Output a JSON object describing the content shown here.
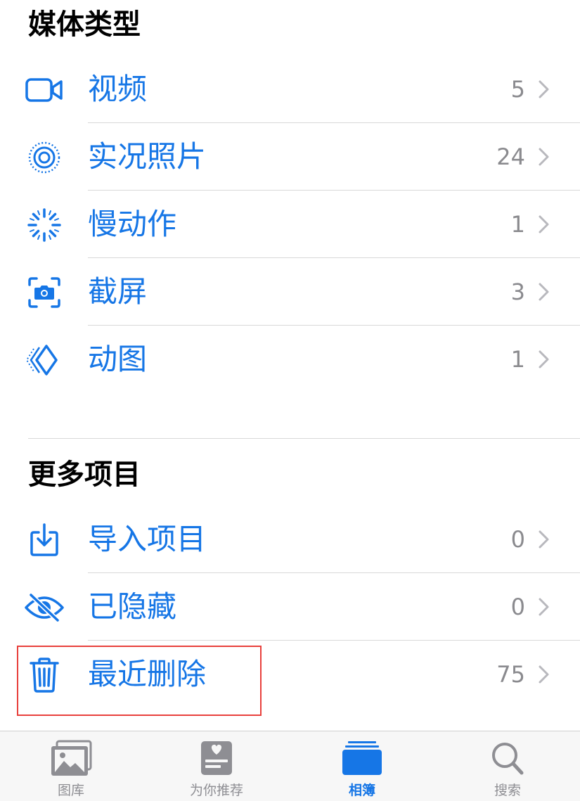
{
  "sections": {
    "media_types": {
      "title": "媒体类型",
      "items": [
        {
          "label": "视频",
          "count": "5",
          "icon": "video-camera-icon"
        },
        {
          "label": "实况照片",
          "count": "24",
          "icon": "live-photo-icon"
        },
        {
          "label": "慢动作",
          "count": "1",
          "icon": "slow-motion-icon"
        },
        {
          "label": "截屏",
          "count": "3",
          "icon": "screenshot-icon"
        },
        {
          "label": "动图",
          "count": "1",
          "icon": "animated-icon"
        }
      ]
    },
    "more_items": {
      "title": "更多项目",
      "items": [
        {
          "label": "导入项目",
          "count": "0",
          "icon": "import-icon"
        },
        {
          "label": "已隐藏",
          "count": "0",
          "icon": "eye-slash-icon"
        },
        {
          "label": "最近删除",
          "count": "75",
          "icon": "trash-icon"
        }
      ]
    }
  },
  "tabbar": {
    "tabs": [
      {
        "label": "图库",
        "icon": "photos-icon",
        "active": false
      },
      {
        "label": "为你推荐",
        "icon": "for-you-icon",
        "active": false
      },
      {
        "label": "相簿",
        "icon": "albums-icon",
        "active": true
      },
      {
        "label": "搜索",
        "icon": "search-icon",
        "active": false
      }
    ]
  },
  "colors": {
    "accent": "#1676e6",
    "count_gray": "#8a8a8e",
    "highlight": "#e8403c"
  }
}
